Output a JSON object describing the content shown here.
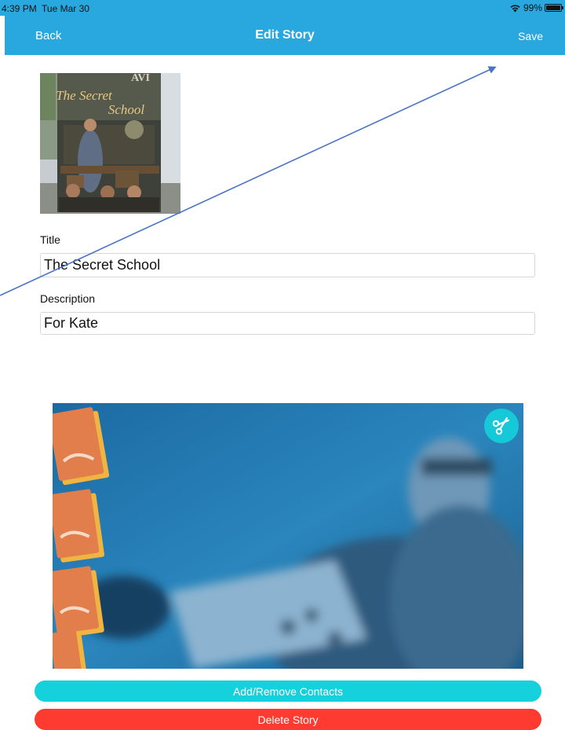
{
  "status_bar": {
    "time": "4:39 PM",
    "date": "Tue Mar 30",
    "battery": "99%",
    "battery_level": 0.99
  },
  "nav": {
    "back_label": "Back",
    "title": "Edit Story",
    "save_label": "Save",
    "color": "#29a8e0"
  },
  "cover": {
    "author": "AVI",
    "book_title_line1": "The Secret",
    "book_title_line2": "School"
  },
  "form": {
    "title_label": "Title",
    "title_value": "The Secret School",
    "description_label": "Description",
    "description_value": "For Kate"
  },
  "video": {
    "trim_icon": "scissors-icon"
  },
  "buttons": {
    "contacts_label": "Add/Remove Contacts",
    "contacts_color": "#15d1dc",
    "delete_label": "Delete Story",
    "delete_color": "#fe3b30"
  },
  "annotation": {
    "arrow_color": "#4a74c4"
  }
}
